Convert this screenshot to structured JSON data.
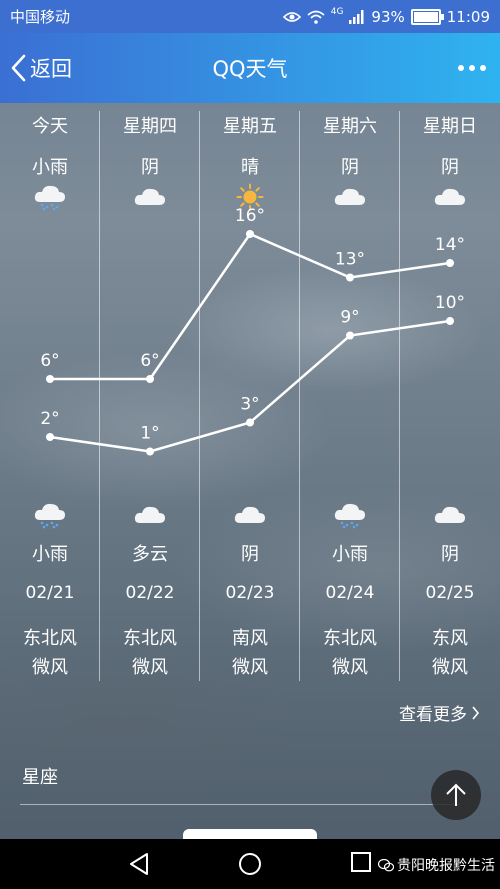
{
  "status": {
    "carrier": "中国移动",
    "signal_tag": "4G",
    "battery": "93%",
    "battery_level": 0.93,
    "time": "11:09"
  },
  "header": {
    "back_label": "返回",
    "title": "QQ天气"
  },
  "days": [
    {
      "name": "今天",
      "day_condition": "小雨",
      "day_icon": "rain-cloud-icon",
      "night_icon": "rain-cloud-icon",
      "night_condition": "小雨",
      "date": "02/21",
      "wind_dir": "东北风",
      "wind_level": "微风",
      "high": "6°",
      "low": "2°",
      "high_val": 6,
      "low_val": 2
    },
    {
      "name": "星期四",
      "day_condition": "阴",
      "day_icon": "cloud-icon",
      "night_icon": "cloud-icon",
      "night_condition": "多云",
      "date": "02/22",
      "wind_dir": "东北风",
      "wind_level": "微风",
      "high": "6°",
      "low": "1°",
      "high_val": 6,
      "low_val": 1
    },
    {
      "name": "星期五",
      "day_condition": "晴",
      "day_icon": "sun-icon",
      "night_icon": "cloud-icon",
      "night_condition": "阴",
      "date": "02/23",
      "wind_dir": "南风",
      "wind_level": "微风",
      "high": "16°",
      "low": "3°",
      "high_val": 16,
      "low_val": 3
    },
    {
      "name": "星期六",
      "day_condition": "阴",
      "day_icon": "cloud-icon",
      "night_icon": "rain-cloud-icon",
      "night_condition": "小雨",
      "date": "02/24",
      "wind_dir": "东北风",
      "wind_level": "微风",
      "high": "13°",
      "low": "9°",
      "high_val": 13,
      "low_val": 9
    },
    {
      "name": "星期日",
      "day_condition": "阴",
      "day_icon": "cloud-icon",
      "night_icon": "cloud-icon",
      "night_condition": "阴",
      "date": "02/25",
      "wind_dir": "东风",
      "wind_level": "微风",
      "high": "14°",
      "low": "10°",
      "high_val": 14,
      "low_val": 10
    }
  ],
  "see_more": "查看更多",
  "section": {
    "title": "星座"
  },
  "watermark": "贵阳晚报黔生活",
  "colors": {
    "status_bar": "#3d6fd0",
    "header_start": "#3b6fd3",
    "header_end": "#2fb3f0",
    "sun": "#f6b73c"
  }
}
